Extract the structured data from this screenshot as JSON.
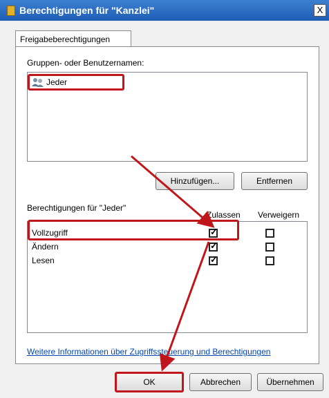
{
  "window": {
    "title": "Berechtigungen für \"Kanzlei\"",
    "close_label": "X"
  },
  "tabs": [
    {
      "label": "Freigabeberechtigungen"
    }
  ],
  "groups": {
    "label": "Gruppen- oder Benutzernamen:",
    "items": [
      {
        "name": "Jeder",
        "icon": "users-icon"
      }
    ],
    "add_label": "Hinzufügen...",
    "remove_label": "Entfernen"
  },
  "permissions": {
    "label": "Berechtigungen für \"Jeder\"",
    "allow_header": "Zulassen",
    "deny_header": "Verweigern",
    "rows": [
      {
        "name": "Vollzugriff",
        "allow": true,
        "deny": false
      },
      {
        "name": "Ändern",
        "allow": true,
        "deny": false
      },
      {
        "name": "Lesen",
        "allow": true,
        "deny": false
      }
    ]
  },
  "info_link": "Weitere Informationen über Zugriffssteuerung und Berechtigungen",
  "footer": {
    "ok_label": "OK",
    "cancel_label": "Abbrechen",
    "apply_label": "Übernehmen"
  },
  "colors": {
    "titlebar": "#1e5eb5",
    "highlight": "#c0161b",
    "arrow": "#c0161b",
    "link": "#0645ad"
  }
}
